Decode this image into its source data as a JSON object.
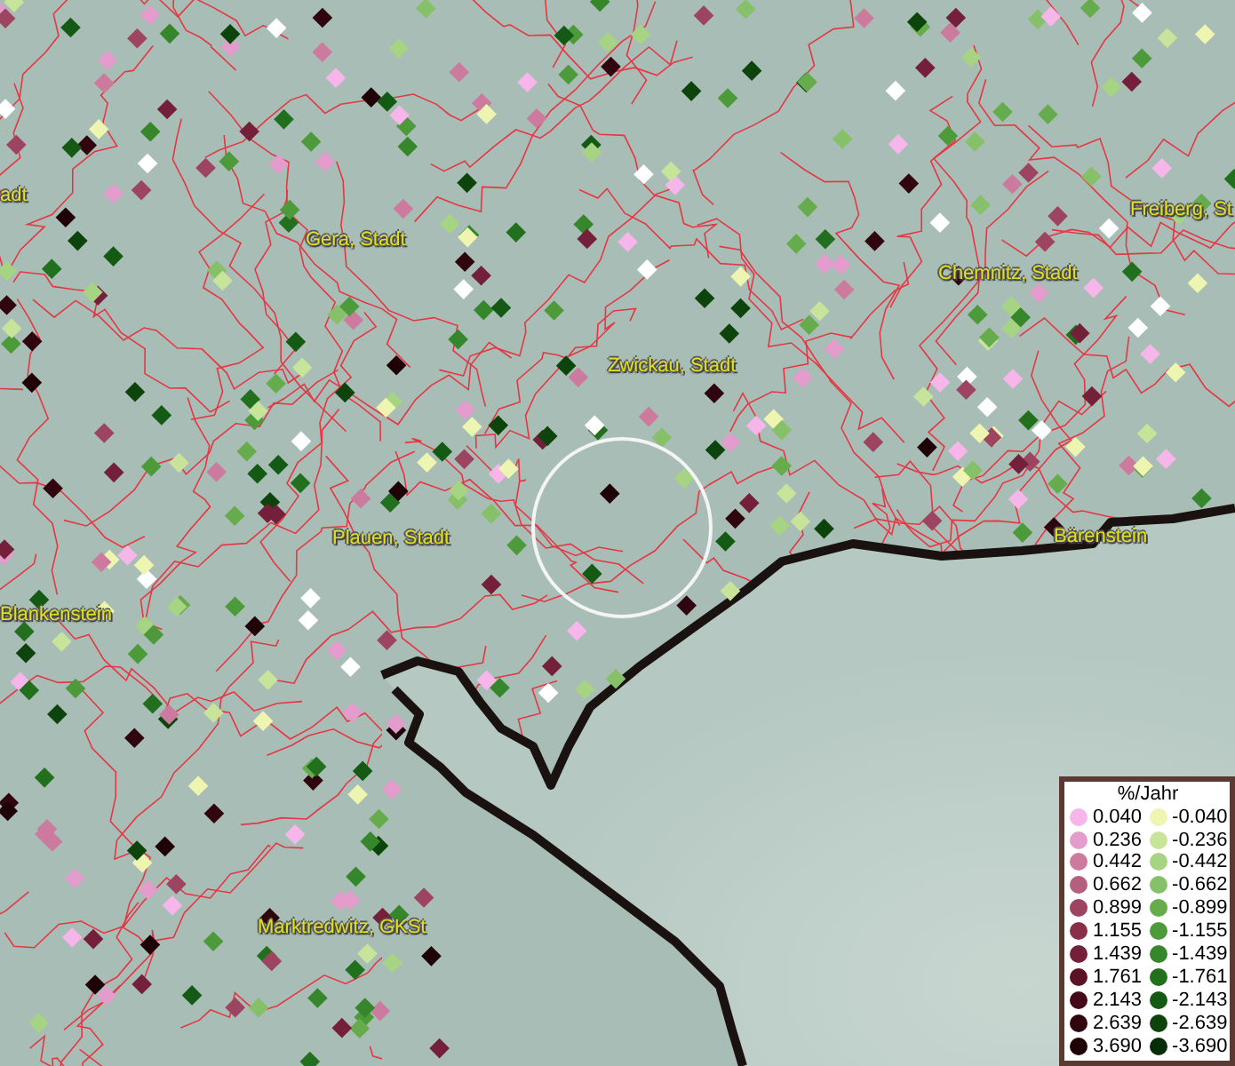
{
  "map": {
    "labels": [
      {
        "text": "adt"
      },
      {
        "text": "Gera, Stadt"
      },
      {
        "text": "Freiberg, St"
      },
      {
        "text": "Chemnitz, Stadt"
      },
      {
        "text": "Zwickau, Stadt"
      },
      {
        "text": "Plauen, Stadt"
      },
      {
        "text": "Blankenstein"
      },
      {
        "text": "Bärenstein"
      },
      {
        "text": "Marktredwitz, GKSt"
      }
    ]
  },
  "legend": {
    "title": "%/Jahr",
    "positive": [
      {
        "value": "0.040",
        "color": "#f7b6ea"
      },
      {
        "value": "0.236",
        "color": "#e39ccb"
      },
      {
        "value": "0.442",
        "color": "#cc7a9e"
      },
      {
        "value": "0.662",
        "color": "#b45f7e"
      },
      {
        "value": "0.899",
        "color": "#9c4460"
      },
      {
        "value": "1.155",
        "color": "#8a2f48"
      },
      {
        "value": "1.439",
        "color": "#74203a"
      },
      {
        "value": "1.761",
        "color": "#5c1226"
      },
      {
        "value": "2.143",
        "color": "#44081a"
      },
      {
        "value": "2.639",
        "color": "#300510"
      },
      {
        "value": "3.690",
        "color": "#1e0208"
      }
    ],
    "negative": [
      {
        "value": "-0.040",
        "color": "#eef5b0"
      },
      {
        "value": "-0.236",
        "color": "#c8e49a"
      },
      {
        "value": "-0.442",
        "color": "#a6d482"
      },
      {
        "value": "-0.662",
        "color": "#86c068"
      },
      {
        "value": "-0.899",
        "color": "#66ac4c"
      },
      {
        "value": "-1.155",
        "color": "#4c9a3a"
      },
      {
        "value": "-1.439",
        "color": "#36862c"
      },
      {
        "value": "-1.761",
        "color": "#22701e"
      },
      {
        "value": "-2.143",
        "color": "#145a14"
      },
      {
        "value": "-2.639",
        "color": "#0c440c"
      },
      {
        "value": "-3.690",
        "color": "#062e06"
      }
    ]
  }
}
